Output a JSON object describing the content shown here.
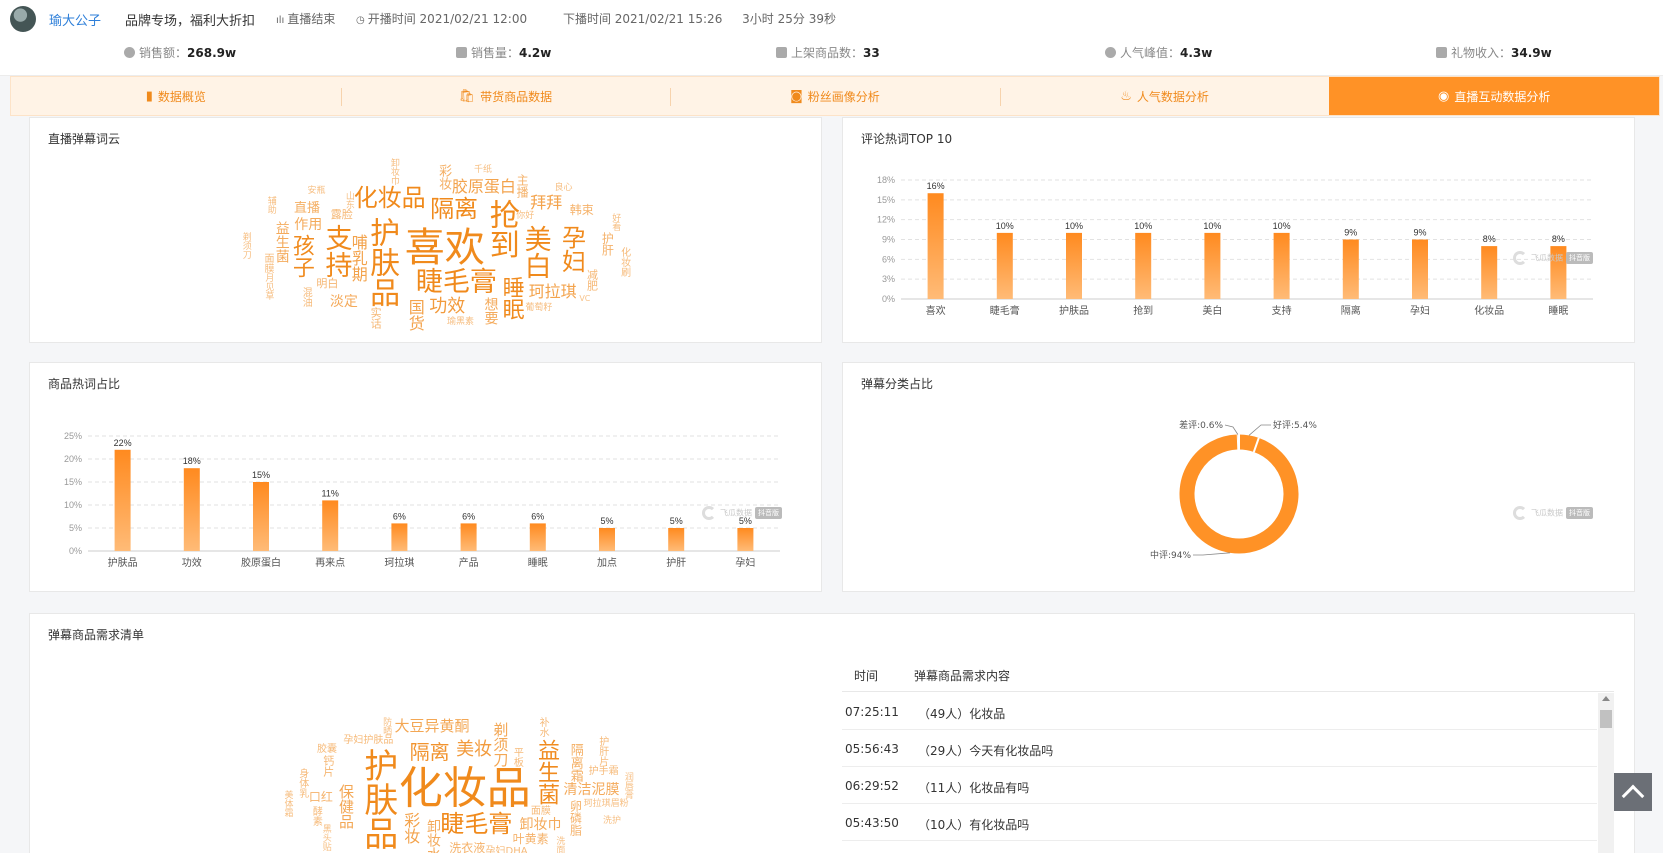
{
  "header": {
    "streamer": "瑜大公子",
    "title": "品牌专场，福利大折扣",
    "status": "直播结束",
    "start_time": "开播时间 2021/02/21 12:00",
    "end_time": "下播时间 2021/02/21 15:26",
    "duration": "3小时 25分 39秒"
  },
  "stats": [
    {
      "label": "销售额：",
      "value": "268.9w",
      "icon": "sales-icon"
    },
    {
      "label": "销售量：",
      "value": "4.2w",
      "icon": "volume-chart-icon"
    },
    {
      "label": "上架商品数：",
      "value": "33",
      "icon": "shelf-icon"
    },
    {
      "label": "人气峰值：",
      "value": "4.3w",
      "icon": "fire-icon"
    },
    {
      "label": "礼物收入：",
      "value": "34.9w",
      "icon": "gift-icon"
    }
  ],
  "tabs": [
    {
      "label": "数据概览",
      "icon": "bar-chart-icon",
      "glyph": "▮"
    },
    {
      "label": "带货商品数据",
      "icon": "bag-icon",
      "glyph": "🛍"
    },
    {
      "label": "粉丝画像分析",
      "icon": "portrait-icon",
      "glyph": "◙"
    },
    {
      "label": "人气数据分析",
      "icon": "fire-icon",
      "glyph": "♨"
    },
    {
      "label": "直播互动数据分析",
      "icon": "interaction-icon",
      "glyph": "◉",
      "active": true
    }
  ],
  "cards": {
    "barrage_cloud": "直播弹幕词云",
    "comment_top10": "评论热词TOP 10",
    "product_hotwords": "商品热词占比",
    "barrage_category": "弹幕分类占比",
    "demand_list": "弹幕商品需求清单"
  },
  "wordcloud1": [
    {
      "t": "喜欢",
      "s": 40
    },
    {
      "t": "护肤品",
      "s": 30
    },
    {
      "t": "睫毛膏",
      "s": 27
    },
    {
      "t": "抢到",
      "s": 30
    },
    {
      "t": "美白",
      "s": 27
    },
    {
      "t": "支持",
      "s": 27
    },
    {
      "t": "隔离",
      "s": 24
    },
    {
      "t": "孕妇",
      "s": 24
    },
    {
      "t": "化妆品",
      "s": 24
    },
    {
      "t": "睡眠",
      "s": 22
    },
    {
      "t": "孩子",
      "s": 22
    },
    {
      "t": "功效",
      "s": 18
    },
    {
      "t": "胶原蛋白",
      "s": 16
    },
    {
      "t": "哺乳期",
      "s": 16
    },
    {
      "t": "拜拜",
      "s": 16
    },
    {
      "t": "珂拉琪",
      "s": 16
    },
    {
      "t": "国货",
      "s": 16
    },
    {
      "t": "作用",
      "s": 14
    },
    {
      "t": "淡定",
      "s": 14
    },
    {
      "t": "益生菌",
      "s": 14
    },
    {
      "t": "想要",
      "s": 14
    },
    {
      "t": "直播",
      "s": 13
    },
    {
      "t": "彩妆",
      "s": 13
    },
    {
      "t": "主播",
      "s": 12
    },
    {
      "t": "韩束",
      "s": 12
    },
    {
      "t": "护肝",
      "s": 12
    },
    {
      "t": "减肥",
      "s": 11
    },
    {
      "t": "露脸",
      "s": 11
    },
    {
      "t": "实话",
      "s": 11
    },
    {
      "t": "明白",
      "s": 11
    },
    {
      "t": "混油",
      "s": 10
    },
    {
      "t": "面膜",
      "s": 10
    },
    {
      "t": "化妆刷",
      "s": 10
    },
    {
      "t": "你好",
      "s": 9
    },
    {
      "t": "山东",
      "s": 9
    },
    {
      "t": "葡萄籽",
      "s": 9
    },
    {
      "t": "卸妆巾",
      "s": 9
    },
    {
      "t": "月见草",
      "s": 9
    },
    {
      "t": "瑜黑素",
      "s": 9
    },
    {
      "t": "安瓶",
      "s": 9
    },
    {
      "t": "剃须刀",
      "s": 9
    },
    {
      "t": "好看",
      "s": 9
    },
    {
      "t": "千纸",
      "s": 9
    },
    {
      "t": "辅助",
      "s": 9
    },
    {
      "t": "良心",
      "s": 9
    },
    {
      "t": "VC",
      "s": 8
    }
  ],
  "chart_data": [
    {
      "type": "bar",
      "title": "评论热词TOP 10",
      "categories": [
        "喜欢",
        "睫毛膏",
        "护肤品",
        "抢到",
        "美白",
        "支持",
        "隔离",
        "孕妇",
        "化妆品",
        "睡眠"
      ],
      "values": [
        16,
        10,
        10,
        10,
        10,
        10,
        9,
        9,
        8,
        8
      ],
      "value_labels": [
        "16%",
        "10%",
        "10%",
        "10%",
        "10%",
        "10%",
        "9%",
        "9%",
        "8%",
        "8%"
      ],
      "yticks": [
        "0%",
        "3%",
        "6%",
        "9%",
        "12%",
        "15%",
        "18%"
      ],
      "ylim": [
        0,
        18
      ],
      "grid": true
    },
    {
      "type": "bar",
      "title": "商品热词占比",
      "categories": [
        "护肤品",
        "功效",
        "胶原蛋白",
        "再来点",
        "珂拉琪",
        "产品",
        "睡眠",
        "加点",
        "护肝",
        "孕妇"
      ],
      "values": [
        22,
        18,
        15,
        11,
        6,
        6,
        6,
        5,
        5,
        5
      ],
      "value_labels": [
        "22%",
        "18%",
        "15%",
        "11%",
        "6%",
        "6%",
        "6%",
        "5%",
        "5%",
        "5%"
      ],
      "yticks": [
        "0%",
        "5%",
        "10%",
        "15%",
        "20%",
        "25%"
      ],
      "ylim": [
        0,
        25
      ],
      "grid": true
    },
    {
      "type": "pie",
      "title": "弹幕分类占比",
      "slices": [
        {
          "name": "中评",
          "value": 94,
          "label": "中评:94%"
        },
        {
          "name": "好评",
          "value": 5.4,
          "label": "好评:5.4%"
        },
        {
          "name": "差评",
          "value": 0.6,
          "label": "差评:0.6%"
        }
      ],
      "donut": true
    }
  ],
  "watermark": {
    "brand": "飞瓜数据",
    "tag": "抖音版",
    "url": "dy.feigua.cn"
  },
  "wordcloud2": [
    {
      "t": "化妆品",
      "s": 44
    },
    {
      "t": "护肤品",
      "s": 34
    },
    {
      "t": "睫毛膏",
      "s": 24
    },
    {
      "t": "隔离",
      "s": 20
    },
    {
      "t": "益生菌",
      "s": 22
    },
    {
      "t": "美妆",
      "s": 18
    },
    {
      "t": "彩妆",
      "s": 16
    },
    {
      "t": "剃须刀",
      "s": 15
    },
    {
      "t": "卸妆巾",
      "s": 14
    },
    {
      "t": "清洁泥膜",
      "s": 14
    },
    {
      "t": "卸妆水",
      "s": 14
    },
    {
      "t": "保健品",
      "s": 15
    },
    {
      "t": "大豆异黄酮",
      "s": 15
    },
    {
      "t": "隔离霜",
      "s": 13
    },
    {
      "t": "叶黄素",
      "s": 12
    },
    {
      "t": "洗衣液",
      "s": 12
    },
    {
      "t": "卵磷脂",
      "s": 12
    },
    {
      "t": "口红",
      "s": 12
    },
    {
      "t": "钙片",
      "s": 11
    },
    {
      "t": "身体乳",
      "s": 10
    },
    {
      "t": "孕妇护肤品",
      "s": 10
    },
    {
      "t": "珂拉琪眉粉",
      "s": 9
    },
    {
      "t": "平板",
      "s": 10
    },
    {
      "t": "护肝片",
      "s": 10
    },
    {
      "t": "面膜",
      "s": 10
    },
    {
      "t": "酵素",
      "s": 10
    },
    {
      "t": "孕妇DHA",
      "s": 10
    },
    {
      "t": "护手霜",
      "s": 10
    },
    {
      "t": "补水",
      "s": 10
    },
    {
      "t": "胶囊",
      "s": 10
    },
    {
      "t": "润唇膏",
      "s": 9
    },
    {
      "t": "洗面奶",
      "s": 9
    },
    {
      "t": "黑头贴",
      "s": 9
    },
    {
      "t": "防晒",
      "s": 9
    },
    {
      "t": "美体霜",
      "s": 9
    },
    {
      "t": "洗护",
      "s": 9
    }
  ],
  "demand": {
    "col_time": "时间",
    "col_content": "弹幕商品需求内容",
    "rows": [
      {
        "time": "07:25:11",
        "content": "（49人）化妆品"
      },
      {
        "time": "05:56:43",
        "content": "（29人）今天有化妆品吗"
      },
      {
        "time": "06:29:52",
        "content": "（11人）化妆品有吗"
      },
      {
        "time": "05:43:50",
        "content": "（10人）有化妆品吗"
      }
    ]
  }
}
